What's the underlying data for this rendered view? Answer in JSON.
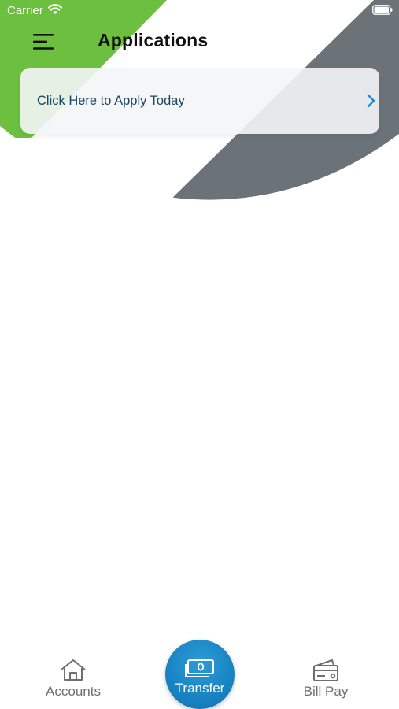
{
  "status_bar": {
    "carrier": "Carrier"
  },
  "header": {
    "title": "Applications"
  },
  "apply_card": {
    "label": "Click Here to Apply Today"
  },
  "tab_bar": {
    "accounts": "Accounts",
    "transfer": "Transfer",
    "bill_pay": "Bill Pay"
  },
  "colors": {
    "brand_green": "#6cbf3f",
    "brand_gray": "#6c7378",
    "accent_blue": "#167fbf",
    "card_text": "#1b4660"
  },
  "icons": {
    "menu": "hamburger-icon",
    "chevron": "chevron-right-icon",
    "accounts": "home-icon",
    "transfer": "cash-icon",
    "bill_pay": "wallet-card-icon",
    "wifi": "wifi-icon",
    "battery": "battery-icon"
  }
}
